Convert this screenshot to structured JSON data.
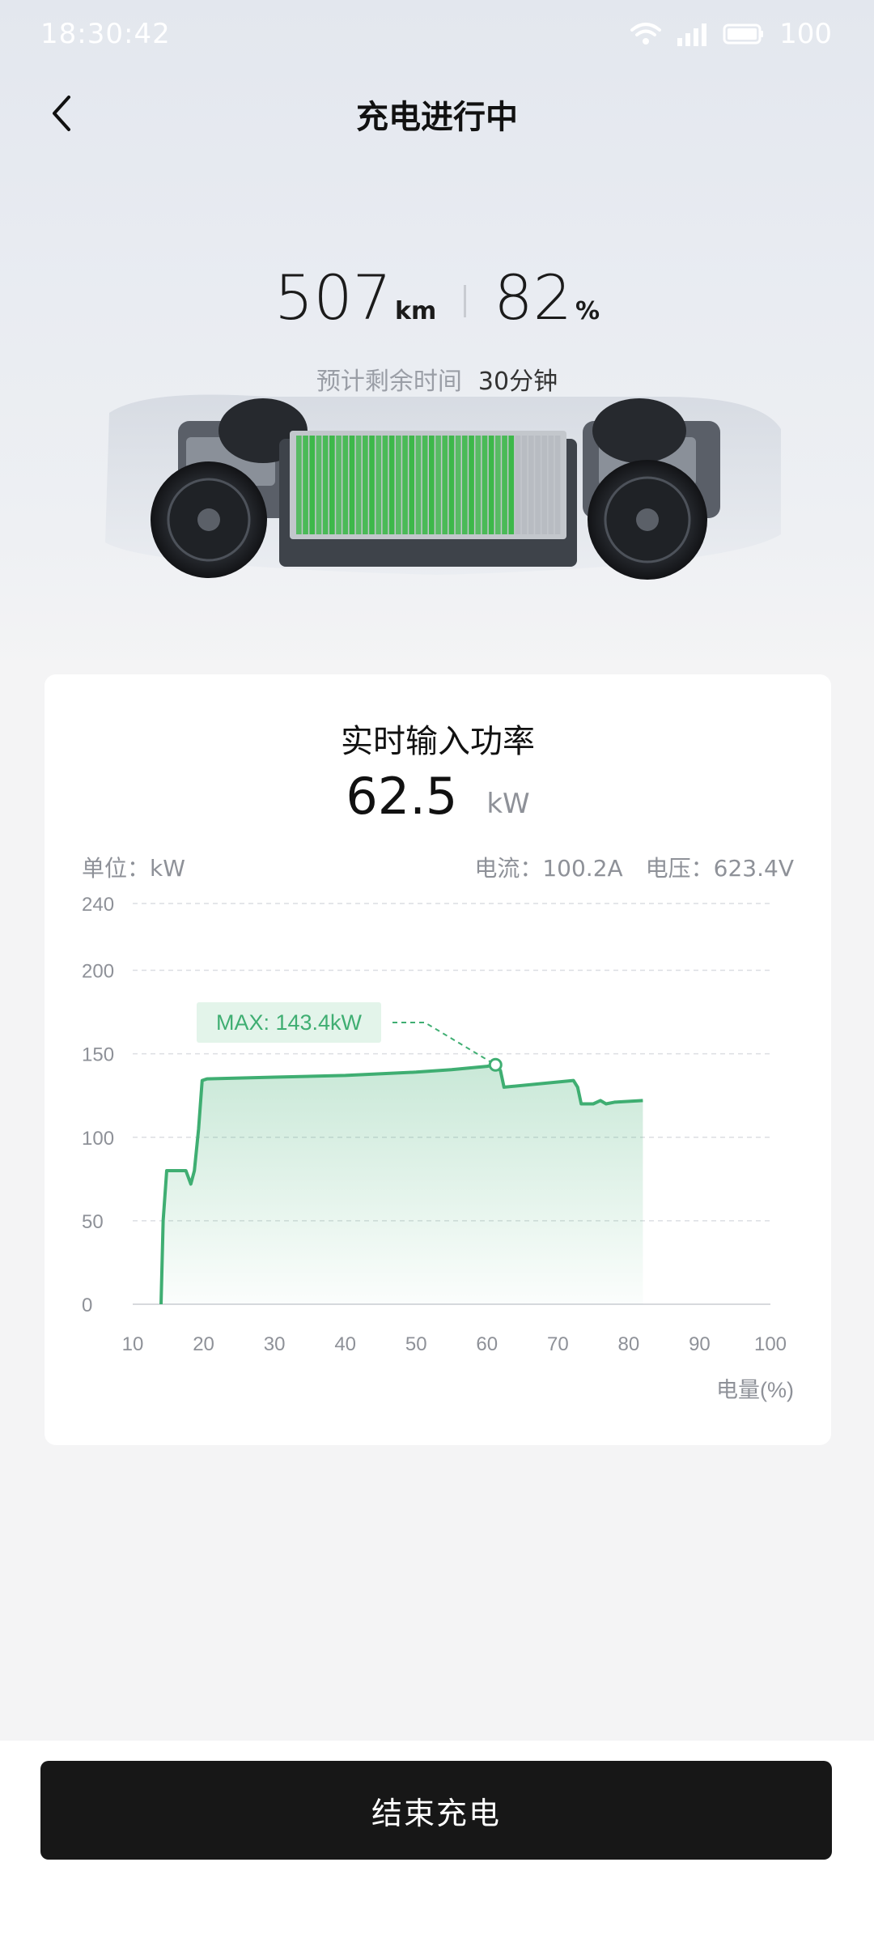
{
  "status_bar": {
    "time": "18:30:42",
    "battery": "100",
    "icons": [
      "wifi-icon",
      "signal-icon",
      "battery-icon"
    ]
  },
  "header": {
    "title": "充电进行中",
    "back_icon": "chevron-left-icon"
  },
  "summary": {
    "range_value": "507",
    "range_unit": "km",
    "soc_value": "82",
    "soc_unit": "%",
    "eta_label": "预计剩余时间",
    "eta_value": "30分钟"
  },
  "battery_pack": {
    "fill_fraction": 0.82,
    "fill_color": "#3db84a"
  },
  "power_card": {
    "title": "实时输入功率",
    "value": "62.5",
    "unit": "kW",
    "unit_label": "单位：kW",
    "current_label": "电流：100.2A",
    "voltage_label": "电压：623.4V"
  },
  "chart_data": {
    "type": "area",
    "title": "",
    "xlabel": "电量(%)",
    "ylabel": "",
    "xlim": [
      10,
      100
    ],
    "ylim": [
      0,
      240
    ],
    "x_ticks": [
      10,
      20,
      30,
      40,
      50,
      60,
      70,
      80,
      90,
      100
    ],
    "y_ticks": [
      0,
      50,
      100,
      150,
      200,
      240
    ],
    "grid": true,
    "line_color": "#3fae72",
    "series": [
      {
        "name": "",
        "x": [
          14.0,
          14.3,
          14.8,
          17.5,
          18.2,
          18.7,
          19.3,
          19.8,
          20.5,
          30,
          40,
          50,
          55,
          60,
          61.2,
          61.9,
          62.4,
          72.2,
          72.8,
          73.3,
          75.0,
          76.0,
          76.8,
          78.0,
          82.0
        ],
        "y": [
          0,
          50,
          80,
          80,
          72,
          80,
          105,
          134,
          135,
          136,
          137,
          139,
          140.5,
          142.5,
          143.4,
          140,
          130,
          134,
          130,
          120,
          120,
          122,
          120,
          121,
          122
        ]
      }
    ],
    "annotations": [
      {
        "text": "MAX: 143.4kW",
        "x": 61.2,
        "y": 143.4
      }
    ]
  },
  "footer": {
    "end_button": "结束充电"
  }
}
